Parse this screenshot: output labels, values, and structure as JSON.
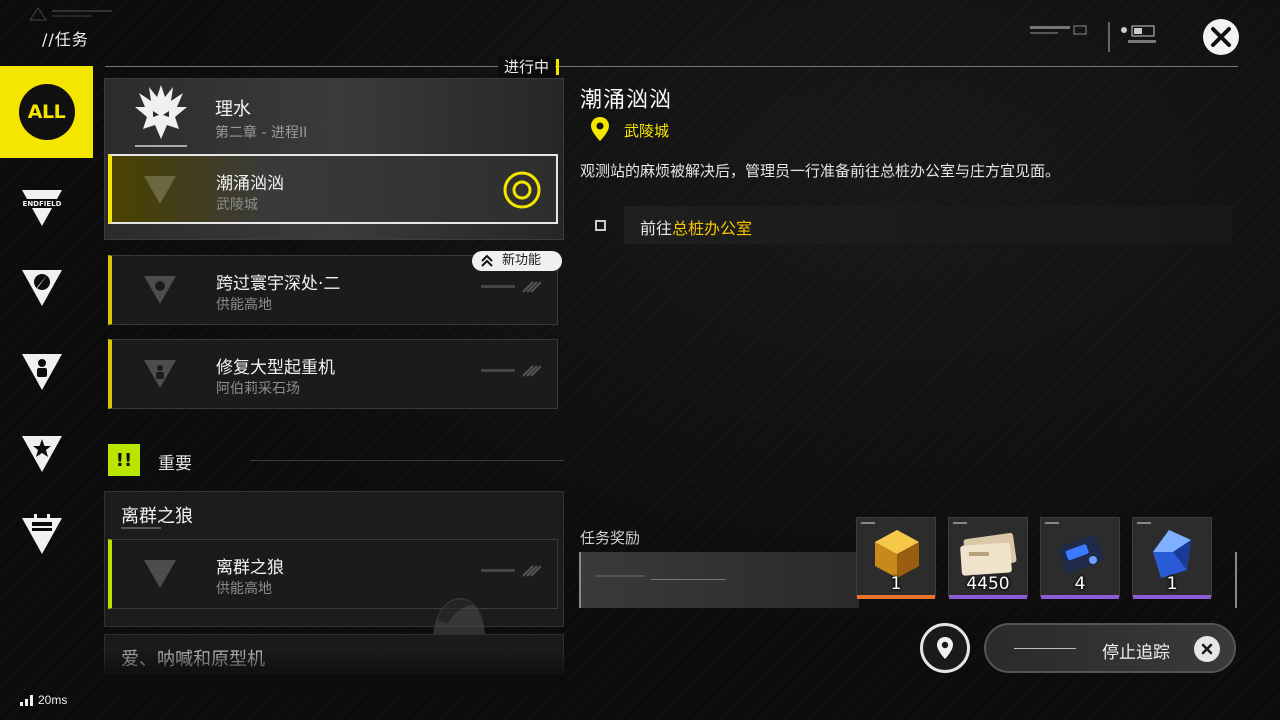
{
  "header": {
    "title": "//任务",
    "status": "进行中"
  },
  "sidebar": {
    "all_label": "ALL",
    "categories": [
      {
        "name": "endfield-icon",
        "label": "ENDFIELD"
      },
      {
        "name": "compass-icon"
      },
      {
        "name": "person-icon"
      },
      {
        "name": "star-icon"
      },
      {
        "name": "box-icon"
      }
    ]
  },
  "quest_list": {
    "group": {
      "title": "理水",
      "subtitle": "第二章 - 进程II"
    },
    "tracked": {
      "title": "潮涌汹汹",
      "location": "武陵城"
    },
    "items": [
      {
        "title": "跨过寰宇深处·二",
        "location": "供能高地",
        "badge": "新功能"
      },
      {
        "title": "修复大型起重机",
        "location": "阿伯莉采石场"
      }
    ],
    "important": {
      "icon_text": "!!",
      "label": "重要",
      "group_title": "离群之狼",
      "quest": {
        "title": "离群之狼",
        "location": "供能高地"
      }
    },
    "last": {
      "title": "爱、呐喊和原型机"
    }
  },
  "detail": {
    "title": "潮涌汹汹",
    "location": "武陵城",
    "description": "观测站的麻烦被解决后，管理员一行准备前往总桩办公室与庄方宜见面。",
    "objective": {
      "prefix": "前往",
      "target": "总桩办公室"
    },
    "rewards_label": "任务奖励",
    "rewards": [
      {
        "name": "gold-crystal-icon",
        "qty": "1",
        "rarity_color": "#e8742a"
      },
      {
        "name": "currency-notes-icon",
        "qty": "4450",
        "rarity_color": "#8b5cd6"
      },
      {
        "name": "blue-device-icon",
        "qty": "4",
        "rarity_color": "#8b5cd6"
      },
      {
        "name": "blue-crystal-icon",
        "qty": "1",
        "rarity_color": "#8b5cd6"
      }
    ],
    "stop_tracking_label": "停止追踪"
  },
  "footer": {
    "ping": "20ms"
  },
  "colors": {
    "accent_yellow": "#f5e600",
    "accent_lime": "#b8e600",
    "location_gold": "#f5c400"
  }
}
